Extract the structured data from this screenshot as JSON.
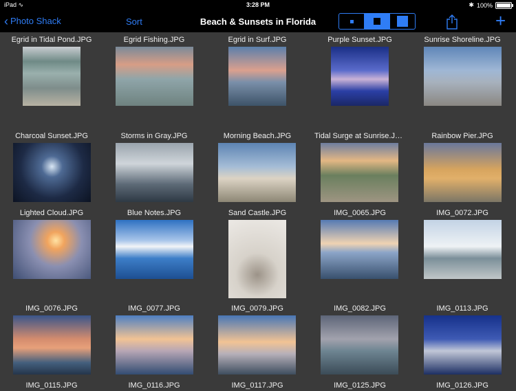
{
  "status": {
    "device": "iPad",
    "time": "3:28 PM",
    "battery": "100%"
  },
  "nav": {
    "back_label": "Photo Shack",
    "sort_label": "Sort",
    "title": "Beach & Sunsets in Florida"
  },
  "photos": [
    {
      "name": "Egrid in Tidal Pond.JPG",
      "g": "linear-gradient(#c8ccd0 0%,#6f8a86 25%,#9ab0ad 45%,#7e8d8b 70%,#b8b2a3 100%)"
    },
    {
      "name": "Egrid Fishing.JPG",
      "g": "linear-gradient(#7a8a99 0%,#d79d86 30%,#8fa5a9 55%,#6e827f 100%)"
    },
    {
      "name": "Egrid in Surf.JPG",
      "g": "linear-gradient(#5b7fab 0%,#dba08e 40%,#7a8fa9 60%,#3d5368 100%)"
    },
    {
      "name": "Purple Sunset.JPG",
      "g": "linear-gradient(#1a2f86 0%,#5a6bcb 40%,#c9b2d6 55%,#2b3fa5 75%,#1a2766 100%)"
    },
    {
      "name": "Sunrise Shoreline.JPG",
      "g": "linear-gradient(#5f86b8 0%,#9fb7d5 40%,#a7b1bd 60%,#8a8782 100%)"
    },
    {
      "name": "Charcoal Sunset.JPG",
      "g": "radial-gradient(circle at 50% 40%,#d8e6f4 0%,#4e6a94 20%,#1d2a45 60%,#0c1322 100%)"
    },
    {
      "name": "Storms in Gray.JPG",
      "g": "linear-gradient(#9aa4ad 0%,#cfd5da 35%,#5d6a77 70%,#2e3944 100%)"
    },
    {
      "name": "Morning Beach.JPG",
      "g": "linear-gradient(#5d84b3 0%,#a4bcd6 40%,#dcd3c4 60%,#8d8775 100%)"
    },
    {
      "name": "Tidal Surge at Sunrise.JPG",
      "g": "linear-gradient(#6e7ea0 0%,#e3b784 30%,#6a7f5e 55%,#9e9582 100%)"
    },
    {
      "name": "Rainbow Pier.JPG",
      "g": "linear-gradient(#6a789c 0%,#d7a45e 45%,#e1b06a 60%,#7c7666 100%)"
    },
    {
      "name": "Lighted Cloud.JPG",
      "g": "radial-gradient(circle at 55% 35%,#ffe3a4 0%,#f1a45e 15%,#8a8fb1 45%,#3e4e73 100%)"
    },
    {
      "name": "Blue Notes.JPG",
      "g": "linear-gradient(#2e71c2 0%,#a9c6ea 35%,#f2f4f7 45%,#3d7ec8 65%,#1d4f92 100%)"
    },
    {
      "name": "Sand Castle.JPG",
      "g": "radial-gradient(circle at 50% 70%,#9c9388 0%,#d7d2ca 35%,#ece9e5 100%)"
    },
    {
      "name": "IMG_0065.JPG",
      "g": "linear-gradient(#557ab3 0%,#efd3b2 40%,#8ca5c8 55%,#38506d 100%)"
    },
    {
      "name": "IMG_0072.JPG",
      "g": "linear-gradient(#c3d3e5 0%,#eef2f5 45%,#7b8f99 65%,#c1c7c8 100%)"
    },
    {
      "name": "IMG_0076.JPG",
      "g": "linear-gradient(#3a558a 0%,#d48c6e 40%,#e7a07a 55%,#445f7d 80%,#24354b 100%)"
    },
    {
      "name": "IMG_0077.JPG",
      "g": "linear-gradient(#4e7fc2 0%,#f1c394 40%,#b7a6b5 60%,#324c72 100%)"
    },
    {
      "name": "IMG_0079.JPG",
      "g": "linear-gradient(#4876b5 0%,#f2c394 45%,#b6b0b9 65%,#3e4d5e 100%)"
    },
    {
      "name": "IMG_0082.JPG",
      "g": "linear-gradient(#5d6578 0%,#a2a2ad 40%,#6e8592 60%,#3b4b57 100%)"
    },
    {
      "name": "IMG_0113.JPG",
      "g": "linear-gradient(#16318a 0%,#3e5ab4 40%,#c1c7d7 60%,#1d2f63 100%)"
    }
  ],
  "next_row": [
    "IMG_0115.JPG",
    "IMG_0116.JPG",
    "IMG_0117.JPG",
    "IMG_0125.JPG",
    "IMG_0126.JPG"
  ],
  "colors": {
    "accent": "#2f7df6",
    "background": "#3a3a3a",
    "bar": "#000000"
  }
}
